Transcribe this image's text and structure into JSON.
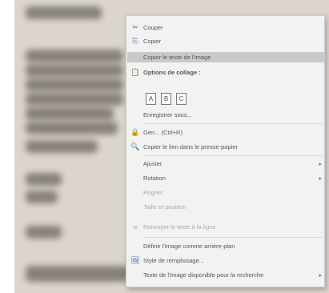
{
  "menu": {
    "items": [
      {
        "label": "Couper",
        "icon": "scissors-icon",
        "glyph": "✂"
      },
      {
        "label": "Copier",
        "icon": "copy-icon",
        "glyph": "⎘"
      },
      {
        "label": "Copier le texte de l'image"
      },
      {
        "label": "Options de collage :",
        "icon": "paste-icon",
        "glyph": "📋"
      },
      {
        "label": "Enregistrer sous..."
      },
      {
        "label": "Gen... (Ctrl+R)",
        "icon": "lock-icon",
        "glyph": "🔒"
      },
      {
        "label": "Copier le lien dans le presse-papier",
        "icon": "search-icon",
        "glyph": "🔍"
      },
      {
        "label": "Ajuster"
      },
      {
        "label": "Rotation"
      },
      {
        "label": "Rogner"
      },
      {
        "label": "Taille et position"
      },
      {
        "label": "Renvoyer le texte à la ligne",
        "icon": "wrap-icon",
        "glyph": "≡"
      },
      {
        "label": "Définir l'image comme arrière-plan"
      },
      {
        "label": "Style de remplissage...",
        "icon": "image-icon",
        "glyph": "🖼"
      },
      {
        "label": "Texte de l'image disponible pour la recherche"
      }
    ],
    "paste_options": [
      "A",
      "B",
      "C"
    ]
  },
  "colors": {
    "menu_bg": "#f2f2f2",
    "highlight": "#c9c9c9",
    "doc_bg": "#dbd5cd"
  }
}
